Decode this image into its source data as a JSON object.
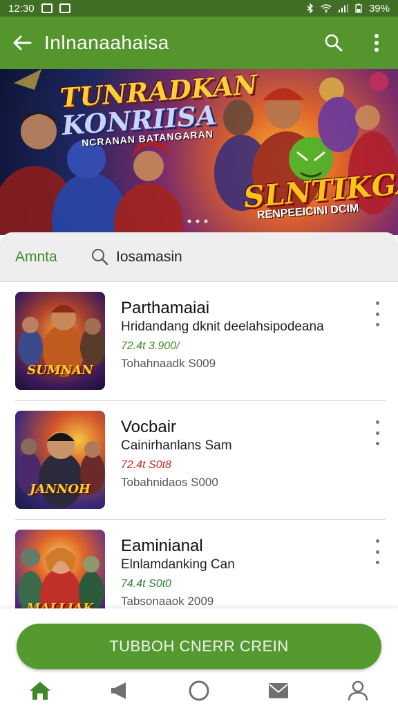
{
  "status_bar": {
    "time": "12:30",
    "battery": "39%"
  },
  "app_bar": {
    "title": "Inlnanaahaisa"
  },
  "hero": {
    "title_line1": "TUNRADKAN",
    "title_line2": "KONRIISA",
    "tagline": "NCRANAN BATANGARAN",
    "secondary_title": "SLNTIKGA",
    "secondary_tagline": "RENPEEICINI DCIM"
  },
  "tabs": {
    "active_tab": "Amnta",
    "search_label": "Iosamasin"
  },
  "games": [
    {
      "name": "Parthamaiai",
      "subtitle": "Hridandang dknit deelahsipodeana",
      "price": "72.4t 3.900/",
      "info": "Tohahnaadk S009",
      "price_color": "#3e8a2a",
      "art_text": "SUMNAN"
    },
    {
      "name": "Vocbair",
      "subtitle": "Cainirhanlans Sam",
      "price": "72.4t S0t8",
      "info": "Tobahnidaos S000",
      "price_color": "#c62828",
      "art_text": "JANNOH"
    },
    {
      "name": "Eaminianal",
      "subtitle": "Elnlamdanking Can",
      "price": "74.4t S0t0",
      "info": "Tabsonaaok 2009",
      "price_color": "#2e7d32",
      "art_text": "MALLIAK"
    }
  ],
  "cta": {
    "label": "TUBBOH CNERR CREIN"
  },
  "colors": {
    "primary": "#55952e",
    "status_bar": "#3f6e24",
    "accent_text": "#3e8a2a"
  },
  "bottom_nav": [
    "home-icon",
    "megaphone-icon",
    "circle-icon",
    "mail-icon",
    "profile-icon"
  ]
}
